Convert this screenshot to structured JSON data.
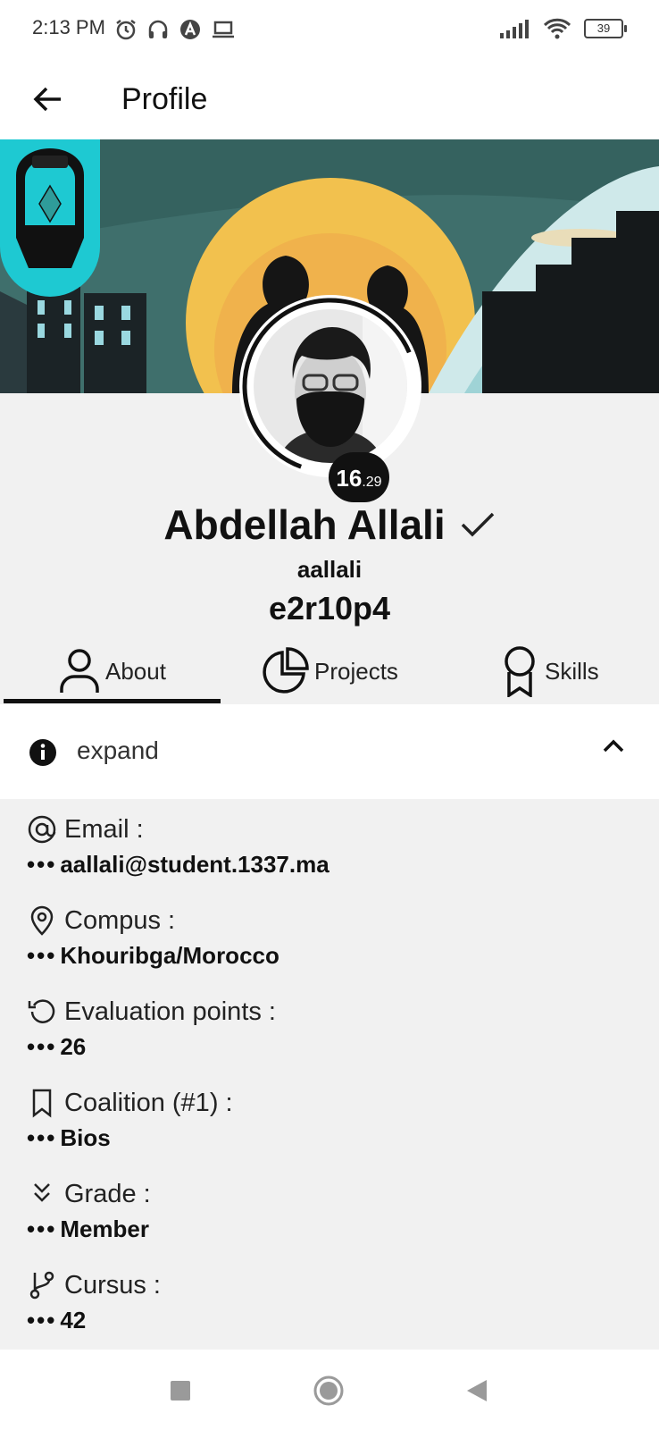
{
  "status_bar": {
    "time": "2:13 PM",
    "battery": "39"
  },
  "app_bar": {
    "title": "Profile"
  },
  "profile": {
    "full_name": "Abdellah Allali",
    "login": "aallali",
    "location": "e2r10p4",
    "level_int": "16",
    "level_frac": ".29"
  },
  "tabs": [
    {
      "label": "About",
      "icon": "person-icon",
      "active": true
    },
    {
      "label": "Projects",
      "icon": "pie-chart-icon",
      "active": false
    },
    {
      "label": "Skills",
      "icon": "award-icon",
      "active": false
    }
  ],
  "expand": {
    "label": "expand"
  },
  "details": [
    {
      "label": "Email :",
      "value": "aallali@student.1337.ma",
      "icon": "at-icon"
    },
    {
      "label": "Compus :",
      "value": "Khouribga/Morocco",
      "icon": "location-pin-icon"
    },
    {
      "label": "Evaluation points :",
      "value": "26",
      "icon": "history-icon"
    },
    {
      "label": "Coalition (#1) :",
      "value": "Bios",
      "icon": "bookmark-icon"
    },
    {
      "label": "Grade :",
      "value": "Member",
      "icon": "double-chevron-down-icon"
    },
    {
      "label": "Cursus :",
      "value": "42",
      "icon": "git-branch-icon"
    }
  ],
  "dots": "•••",
  "colors": {
    "accent": "#111111",
    "banner_sky": "#3f6f6c",
    "sun": "#f2c14e",
    "coalition": "#1ec9d2"
  }
}
